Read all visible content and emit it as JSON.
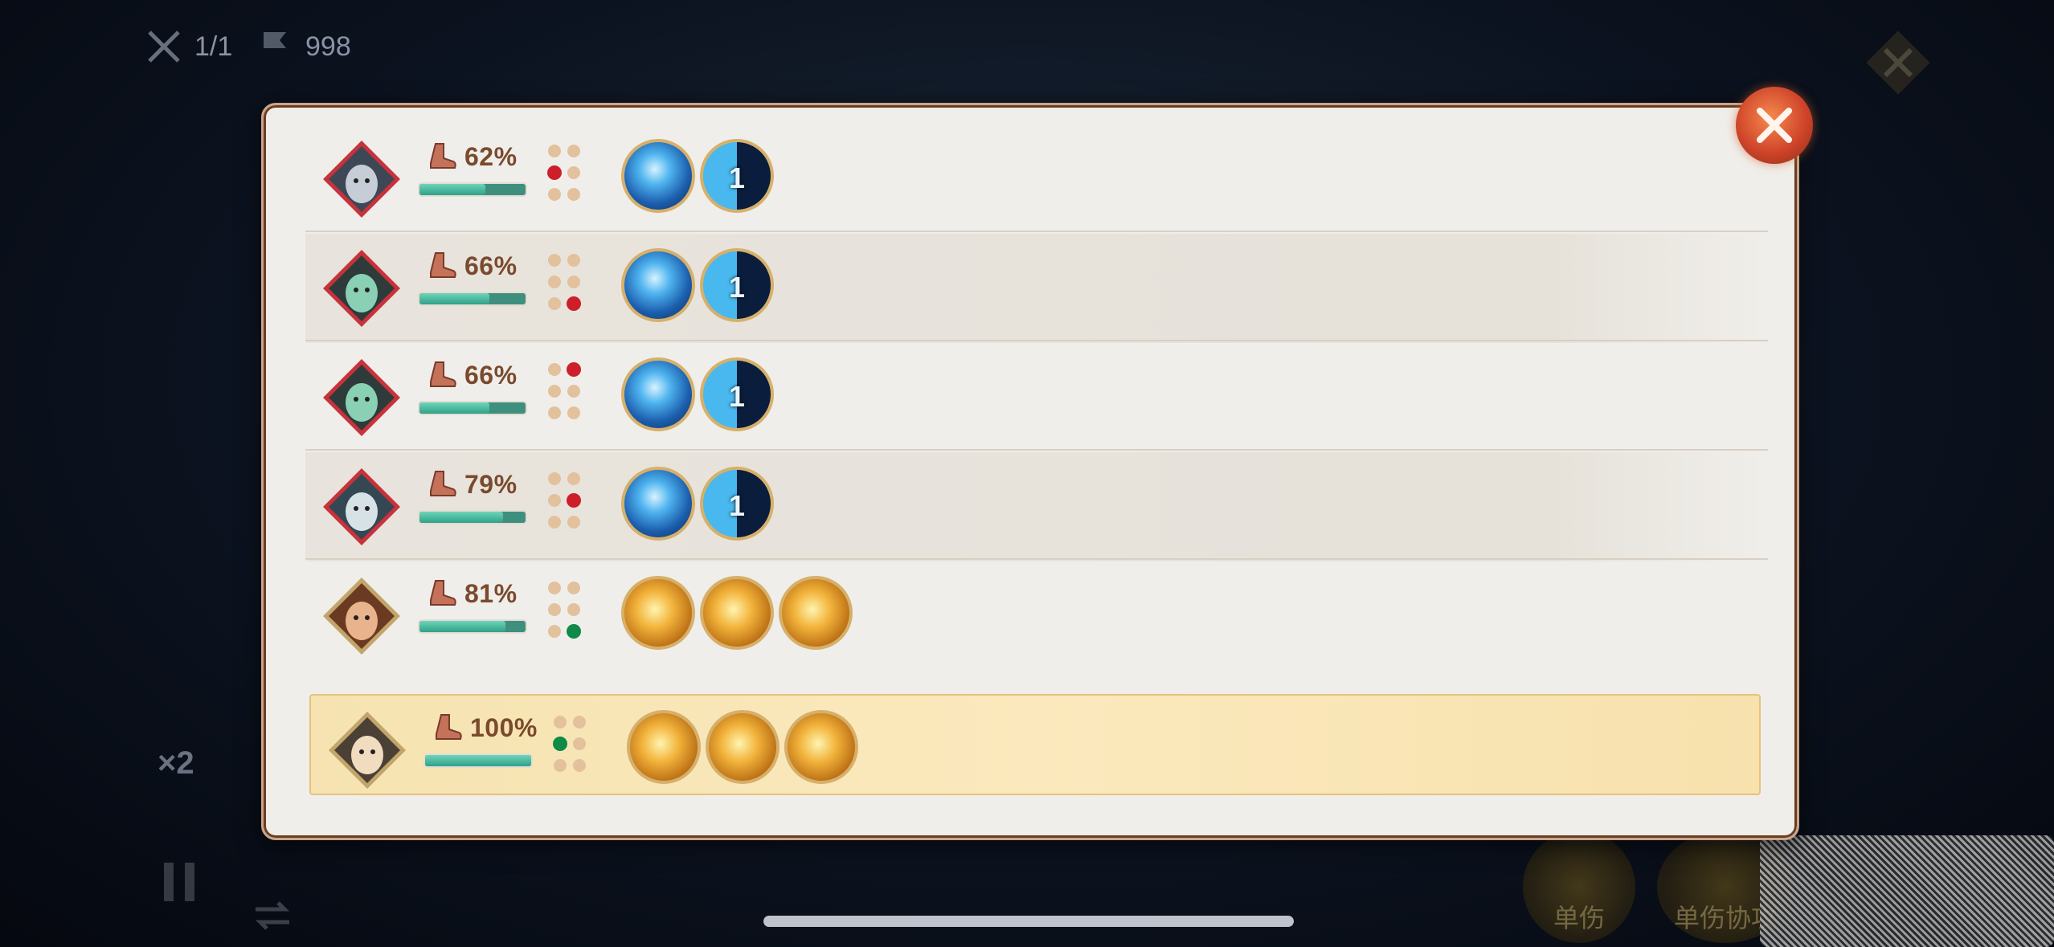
{
  "hud": {
    "stage": "1/1",
    "coins": "998"
  },
  "side": {
    "speed": "×2"
  },
  "bottom_buttons": [
    "单伤",
    "单伤协攻"
  ],
  "units": [
    {
      "hp_label": "62%",
      "hp": 0.62,
      "marker_index": 2,
      "marker_color": "#cc1f2a",
      "skill_type": "blue",
      "skills": [
        "",
        "1"
      ]
    },
    {
      "hp_label": "66%",
      "hp": 0.66,
      "marker_index": 5,
      "marker_color": "#cc1f2a",
      "skill_type": "blue",
      "skills": [
        "",
        "1"
      ]
    },
    {
      "hp_label": "66%",
      "hp": 0.66,
      "marker_index": 1,
      "marker_color": "#cc1f2a",
      "skill_type": "blue",
      "skills": [
        "",
        "1"
      ]
    },
    {
      "hp_label": "79%",
      "hp": 0.79,
      "marker_index": 3,
      "marker_color": "#cc1f2a",
      "skill_type": "blue",
      "skills": [
        "",
        "1"
      ]
    },
    {
      "hp_label": "81%",
      "hp": 0.81,
      "marker_index": 5,
      "marker_color": "#0f8a47",
      "skill_type": "gold",
      "skills": [
        "",
        "",
        ""
      ]
    },
    {
      "hp_label": "100%",
      "hp": 1.0,
      "marker_index": 2,
      "marker_color": "#0f8a47",
      "skill_type": "gold",
      "skills": [
        "",
        "",
        ""
      ],
      "active": true
    }
  ],
  "icons": {
    "close": "close-icon",
    "boot": "boot-icon",
    "swords": "crossed-swords-icon",
    "flag": "flag-icon"
  }
}
